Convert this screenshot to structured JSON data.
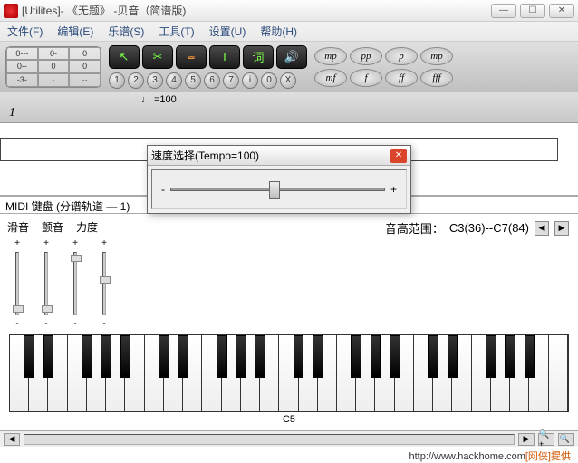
{
  "window": {
    "title": "[Utilites]- 《无题》 -贝音（简谱版)"
  },
  "menu": {
    "file": "文件(F)",
    "edit": "编辑(E)",
    "score": "乐谱(S)",
    "tool": "工具(T)",
    "setup": "设置(U)",
    "help": "帮助(H)"
  },
  "durations": [
    "0---",
    "0-",
    "0",
    "0--",
    "0",
    "0",
    "-3-",
    "·",
    "··"
  ],
  "tools": {
    "pointer": "↖",
    "cut": "✂",
    "metronome": "⏕",
    "text": "T",
    "lyric": "词",
    "sound": "🔊"
  },
  "dynamics": [
    "mp",
    "pp",
    "p",
    "mp",
    "mf",
    "f",
    "ff",
    "fff"
  ],
  "nums": [
    "1",
    "2",
    "3",
    "4",
    "5",
    "6",
    "7",
    "ⅰ",
    "0",
    "X"
  ],
  "ruler": {
    "tempo_text": "=100",
    "measure": "1"
  },
  "tempoDlg": {
    "title": "速度选择(Tempo=100)",
    "minus": "-",
    "plus": "+"
  },
  "midiPanel": {
    "title": "MIDI 键盘 (分谱轨道 — 1)",
    "slide": {
      "glide": "滑音",
      "vibrato": "颤音",
      "velocity": "力度"
    },
    "rangeLabel": "音高范围：",
    "rangeValue": "C3(36)--C7(84)",
    "c5": "C5",
    "plus": "+",
    "minus": "-",
    "left": "◀",
    "right": "▶"
  },
  "status": {
    "left": "◀",
    "right": "▶",
    "zoomin": "🔍+",
    "zoomout": "🔍-"
  },
  "footer": {
    "url": "http://www.hackhome.com",
    "tag": "[网侠]提供"
  }
}
